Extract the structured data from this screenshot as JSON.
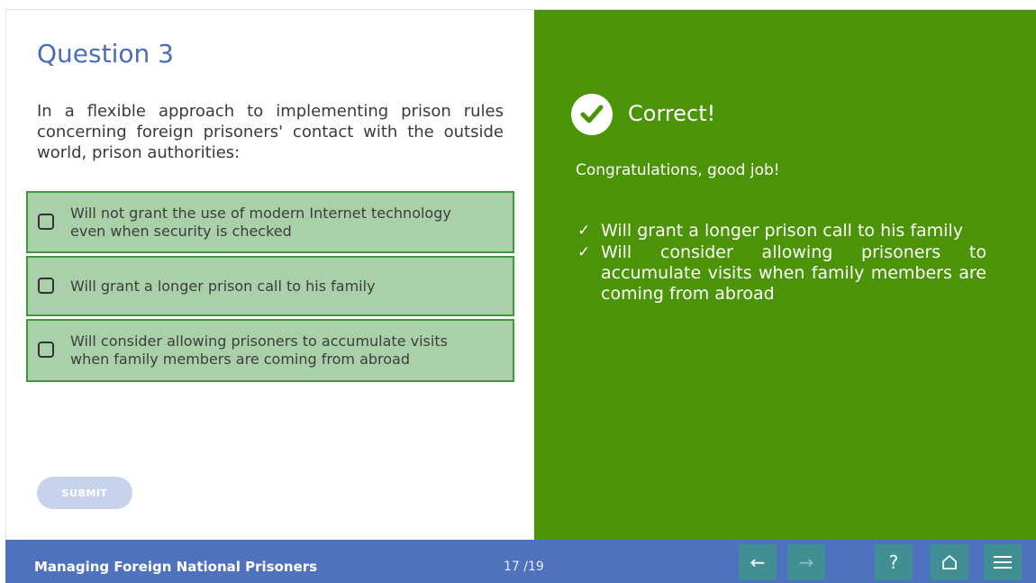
{
  "question": {
    "title": "Question 3",
    "text": "In a flexible approach to implementing prison rules concerning foreign prisoners' contact with the outside world, prison authorities:",
    "options": [
      {
        "label": "Will not grant the use of modern Internet technology even when security is checked",
        "checked": false
      },
      {
        "label": "Will grant a longer prison call to his family",
        "checked": false
      },
      {
        "label": "Will consider allowing prisoners to  accumulate visits when family members are coming from abroad",
        "checked": false
      }
    ],
    "submit_label": "SUBMIT"
  },
  "feedback": {
    "title": "Correct!",
    "message": "Congratulations, good job!",
    "correct_answers": [
      "Will grant a longer prison call to his family",
      "Will consider allowing prisoners to accumulate visits when family members are coming from abroad"
    ],
    "tick": "✓",
    "icon": "check-circle-icon",
    "background_color": "#4b9307"
  },
  "footer": {
    "course_title": "Managing Foreign National Prisoners",
    "page_counter": "17 /19",
    "prev_icon": "←",
    "next_icon": "→",
    "help_icon": "?",
    "home_icon": "home-icon",
    "menu_icon": "menu-icon",
    "bar_color": "#4f72bf"
  }
}
